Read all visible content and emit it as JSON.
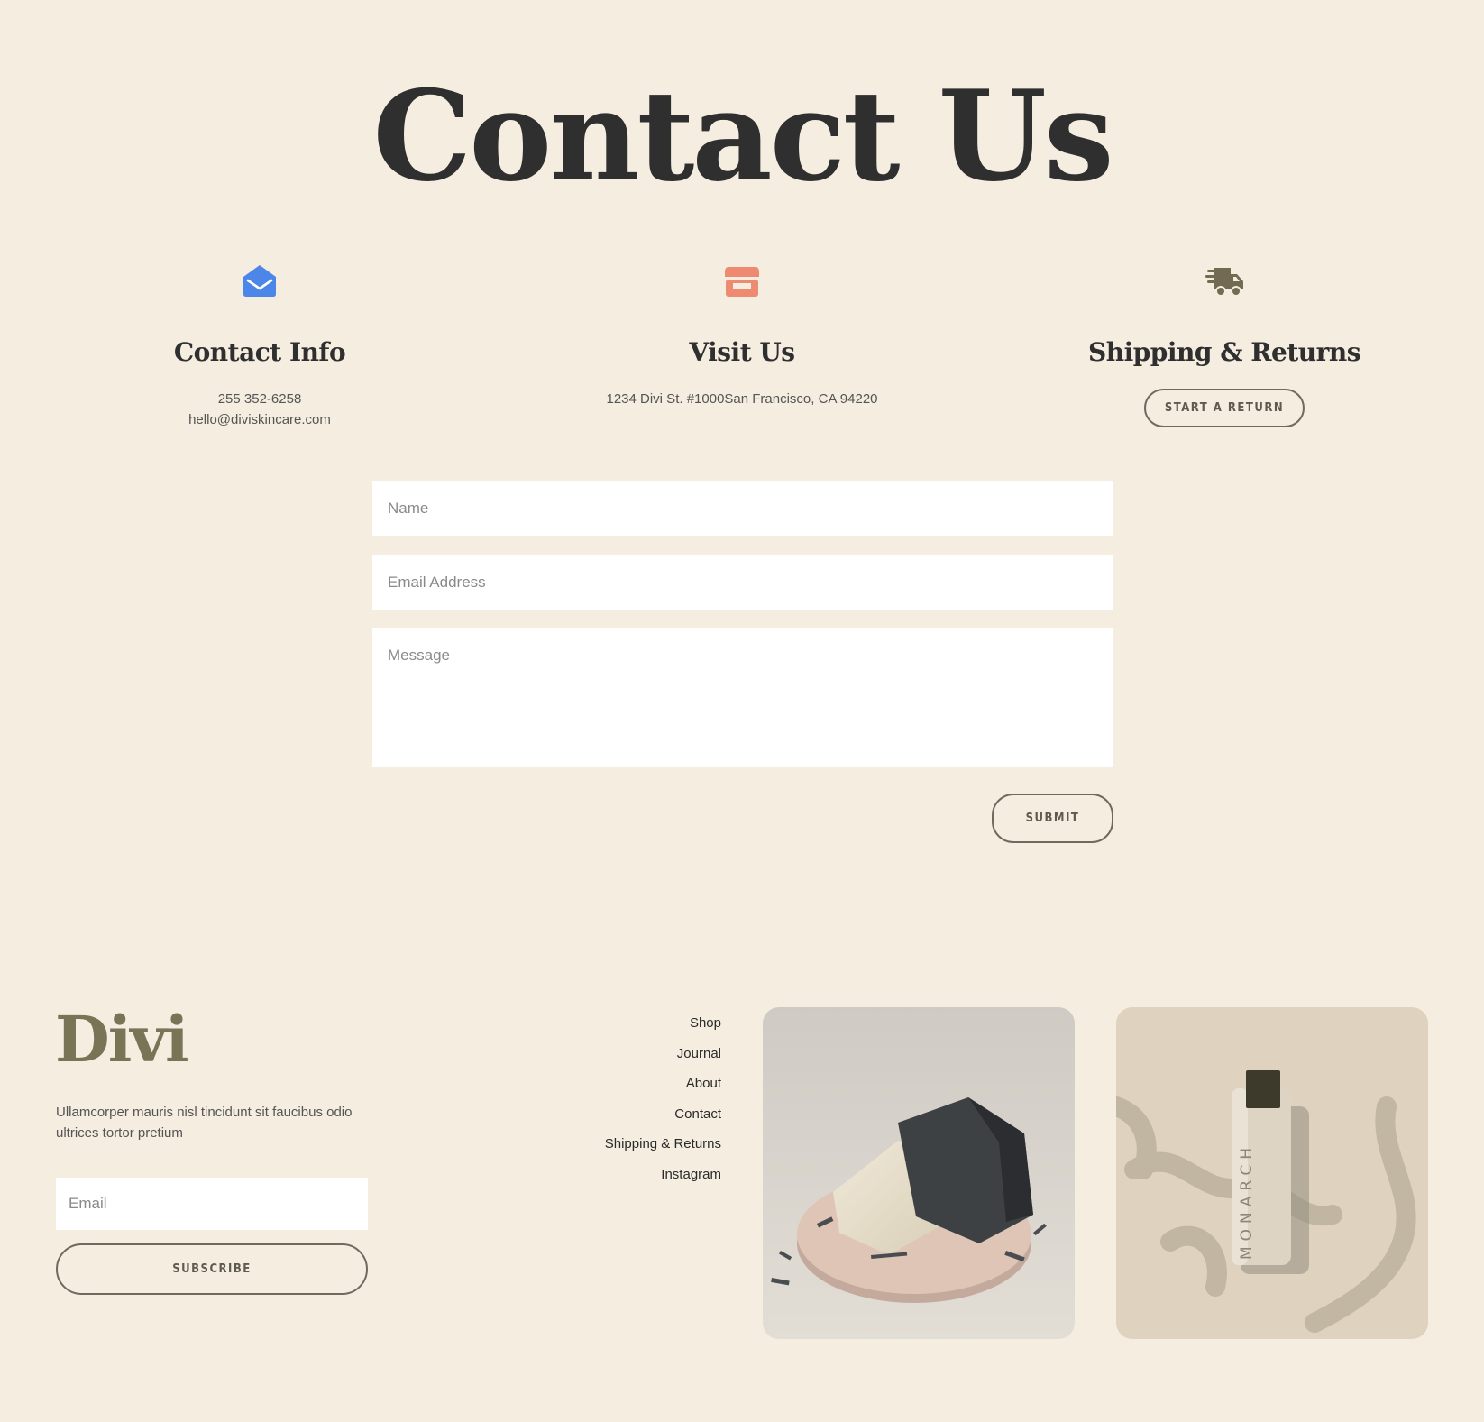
{
  "header": {
    "title": "Contact Us"
  },
  "colors": {
    "background": "#f4ede0",
    "email_icon": "#4c86e8",
    "store_icon": "#ee8a72",
    "truck_icon": "#726b52",
    "brand": "#7a7457"
  },
  "contact_info": {
    "icon": "envelope-open-icon",
    "heading": "Contact Info",
    "phone": "255 352-6258",
    "email": "hello@diviskincare.com"
  },
  "visit_us": {
    "icon": "storefront-icon",
    "heading": "Visit Us",
    "address": "1234 Divi St. #1000San Francisco, CA 94220"
  },
  "shipping": {
    "icon": "shipping-truck-icon",
    "heading": "Shipping & Returns",
    "button_label": "START A RETURN"
  },
  "form": {
    "name_placeholder": "Name",
    "email_placeholder": "Email Address",
    "message_placeholder": "Message",
    "submit_label": "SUBMIT"
  },
  "footer": {
    "logo": "Divi",
    "description": "Ullamcorper mauris nisl tincidunt sit faucibus odio ultrices tortor pretium",
    "email_placeholder": "Email",
    "subscribe_label": "SUBSCRIBE",
    "nav": [
      "Shop",
      "Journal",
      "About",
      "Contact",
      "Shipping & Returns",
      "Instagram"
    ],
    "images": [
      "soap-bars-photo",
      "monarch-bottle-photo"
    ],
    "bottle_label": "MONARCH"
  }
}
